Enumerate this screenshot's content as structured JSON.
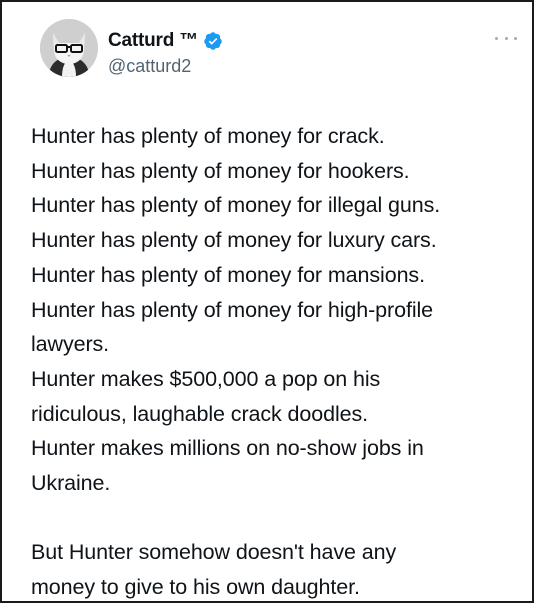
{
  "tweet": {
    "author": {
      "display_name": "Catturd ™",
      "handle": "@catturd2",
      "verified": true,
      "avatar_icon": "cat-with-glasses-avatar",
      "verified_icon": "verified-checkmark-icon",
      "verified_color": "#1d9bf0"
    },
    "more_icon": "more-options-icon",
    "lines": [
      "Hunter has plenty of money for crack.",
      "Hunter has plenty of money for hookers.",
      "Hunter has plenty of money for illegal guns.",
      "Hunter has plenty of money for luxury cars.",
      "Hunter has plenty of money for mansions.",
      "Hunter has plenty of money for high-profile",
      "lawyers.",
      "Hunter makes $500,000 a pop on his",
      "ridiculous, laughable crack doodles.",
      "Hunter makes millions on no-show jobs in",
      "Ukraine.",
      "",
      "But Hunter somehow doesn't have any",
      "money to give to his own daughter."
    ]
  }
}
